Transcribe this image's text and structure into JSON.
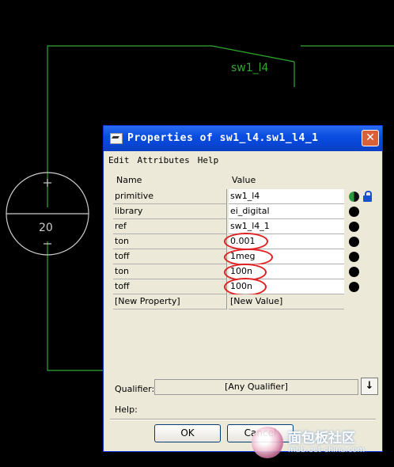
{
  "schematic": {
    "switch_label": "sw1_l4",
    "source_value": "20",
    "wire_color": "#2fa82f"
  },
  "dialog": {
    "title": "Properties of sw1_l4.sw1_l4_1",
    "close_icon": "close-icon",
    "menu": [
      "Edit",
      "Attributes",
      "Help"
    ],
    "columns": {
      "name": "Name",
      "value": "Value"
    },
    "properties": [
      {
        "name": "primitive",
        "value": "sw1_l4"
      },
      {
        "name": "library",
        "value": "ei_digital"
      },
      {
        "name": "ref",
        "value": "sw1_l4_1"
      },
      {
        "name": "ton",
        "value": "0.001"
      },
      {
        "name": "toff",
        "value": "1meg"
      },
      {
        "name": "ton",
        "value": "100n"
      },
      {
        "name": "toff",
        "value": "100n"
      }
    ],
    "new_property": {
      "name": "[New Property]",
      "value": "[New Value]"
    },
    "qualifier_label": "Qualifier:",
    "qualifier_value": "[Any Qualifier]",
    "help_label": "Help:",
    "ok_label": "OK",
    "cancel_label": "Cancel",
    "highlight_color": "#e02020"
  },
  "watermark": {
    "text": "面包板社区",
    "url": "mbb.eet-china.com"
  }
}
